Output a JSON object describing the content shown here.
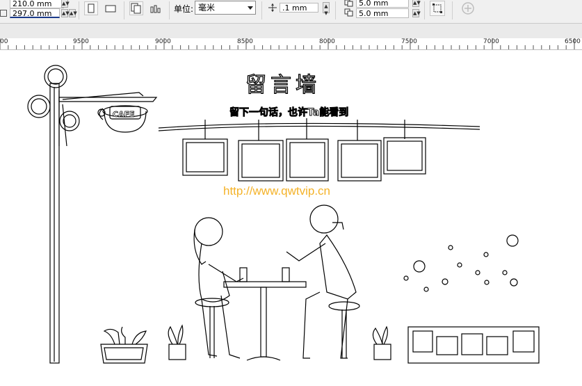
{
  "toolbar": {
    "width_value": "210.0 mm",
    "height_value": "297.0 mm",
    "unit_label": "单位:",
    "unit_value": "毫米",
    "nudge_value": ".1 mm",
    "dup_x_value": "5.0 mm",
    "dup_y_value": "5.0 mm"
  },
  "ruler": {
    "labels": [
      "00",
      "9500",
      "9000",
      "8500",
      "8000",
      "7500",
      "7000",
      "6500"
    ]
  },
  "artwork": {
    "title": "留言墙",
    "subtitle": "留下一句话，也许Ta能看到",
    "cafe_sign": "CAFE",
    "watermark": "http://www.qwtvip.cn"
  },
  "colors": {
    "toolbar_bg": "#f0f0f0",
    "watermark": "#f4b228",
    "line_art": "#000000"
  },
  "icons": [
    "portrait-icon",
    "landscape-icon",
    "all-pages-icon",
    "current-page-icon",
    "nudge-icon",
    "duplicate-x-icon",
    "duplicate-y-icon",
    "treat-as-filled-icon",
    "add-page-icon"
  ]
}
